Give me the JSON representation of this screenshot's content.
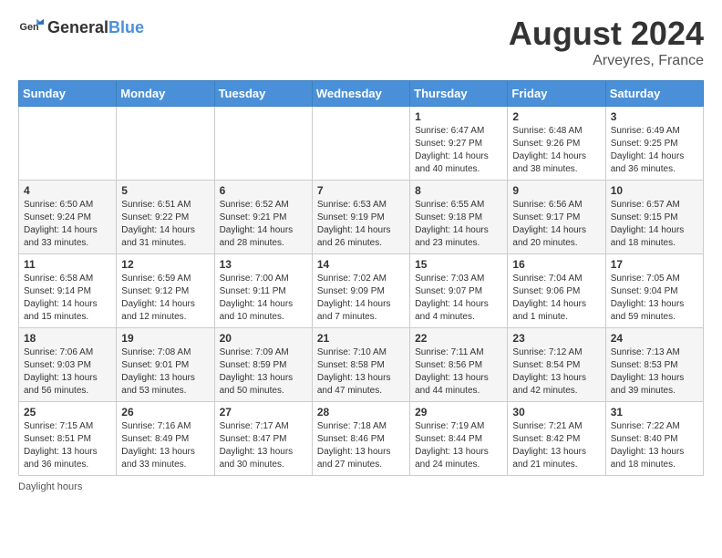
{
  "header": {
    "logo_general": "General",
    "logo_blue": "Blue",
    "month_year": "August 2024",
    "location": "Arveyres, France"
  },
  "footer": {
    "note": "Daylight hours"
  },
  "days_of_week": [
    "Sunday",
    "Monday",
    "Tuesday",
    "Wednesday",
    "Thursday",
    "Friday",
    "Saturday"
  ],
  "weeks": [
    [
      {
        "day": "",
        "info": ""
      },
      {
        "day": "",
        "info": ""
      },
      {
        "day": "",
        "info": ""
      },
      {
        "day": "",
        "info": ""
      },
      {
        "day": "1",
        "info": "Sunrise: 6:47 AM\nSunset: 9:27 PM\nDaylight: 14 hours\nand 40 minutes."
      },
      {
        "day": "2",
        "info": "Sunrise: 6:48 AM\nSunset: 9:26 PM\nDaylight: 14 hours\nand 38 minutes."
      },
      {
        "day": "3",
        "info": "Sunrise: 6:49 AM\nSunset: 9:25 PM\nDaylight: 14 hours\nand 36 minutes."
      }
    ],
    [
      {
        "day": "4",
        "info": "Sunrise: 6:50 AM\nSunset: 9:24 PM\nDaylight: 14 hours\nand 33 minutes."
      },
      {
        "day": "5",
        "info": "Sunrise: 6:51 AM\nSunset: 9:22 PM\nDaylight: 14 hours\nand 31 minutes."
      },
      {
        "day": "6",
        "info": "Sunrise: 6:52 AM\nSunset: 9:21 PM\nDaylight: 14 hours\nand 28 minutes."
      },
      {
        "day": "7",
        "info": "Sunrise: 6:53 AM\nSunset: 9:19 PM\nDaylight: 14 hours\nand 26 minutes."
      },
      {
        "day": "8",
        "info": "Sunrise: 6:55 AM\nSunset: 9:18 PM\nDaylight: 14 hours\nand 23 minutes."
      },
      {
        "day": "9",
        "info": "Sunrise: 6:56 AM\nSunset: 9:17 PM\nDaylight: 14 hours\nand 20 minutes."
      },
      {
        "day": "10",
        "info": "Sunrise: 6:57 AM\nSunset: 9:15 PM\nDaylight: 14 hours\nand 18 minutes."
      }
    ],
    [
      {
        "day": "11",
        "info": "Sunrise: 6:58 AM\nSunset: 9:14 PM\nDaylight: 14 hours\nand 15 minutes."
      },
      {
        "day": "12",
        "info": "Sunrise: 6:59 AM\nSunset: 9:12 PM\nDaylight: 14 hours\nand 12 minutes."
      },
      {
        "day": "13",
        "info": "Sunrise: 7:00 AM\nSunset: 9:11 PM\nDaylight: 14 hours\nand 10 minutes."
      },
      {
        "day": "14",
        "info": "Sunrise: 7:02 AM\nSunset: 9:09 PM\nDaylight: 14 hours\nand 7 minutes."
      },
      {
        "day": "15",
        "info": "Sunrise: 7:03 AM\nSunset: 9:07 PM\nDaylight: 14 hours\nand 4 minutes."
      },
      {
        "day": "16",
        "info": "Sunrise: 7:04 AM\nSunset: 9:06 PM\nDaylight: 14 hours\nand 1 minute."
      },
      {
        "day": "17",
        "info": "Sunrise: 7:05 AM\nSunset: 9:04 PM\nDaylight: 13 hours\nand 59 minutes."
      }
    ],
    [
      {
        "day": "18",
        "info": "Sunrise: 7:06 AM\nSunset: 9:03 PM\nDaylight: 13 hours\nand 56 minutes."
      },
      {
        "day": "19",
        "info": "Sunrise: 7:08 AM\nSunset: 9:01 PM\nDaylight: 13 hours\nand 53 minutes."
      },
      {
        "day": "20",
        "info": "Sunrise: 7:09 AM\nSunset: 8:59 PM\nDaylight: 13 hours\nand 50 minutes."
      },
      {
        "day": "21",
        "info": "Sunrise: 7:10 AM\nSunset: 8:58 PM\nDaylight: 13 hours\nand 47 minutes."
      },
      {
        "day": "22",
        "info": "Sunrise: 7:11 AM\nSunset: 8:56 PM\nDaylight: 13 hours\nand 44 minutes."
      },
      {
        "day": "23",
        "info": "Sunrise: 7:12 AM\nSunset: 8:54 PM\nDaylight: 13 hours\nand 42 minutes."
      },
      {
        "day": "24",
        "info": "Sunrise: 7:13 AM\nSunset: 8:53 PM\nDaylight: 13 hours\nand 39 minutes."
      }
    ],
    [
      {
        "day": "25",
        "info": "Sunrise: 7:15 AM\nSunset: 8:51 PM\nDaylight: 13 hours\nand 36 minutes."
      },
      {
        "day": "26",
        "info": "Sunrise: 7:16 AM\nSunset: 8:49 PM\nDaylight: 13 hours\nand 33 minutes."
      },
      {
        "day": "27",
        "info": "Sunrise: 7:17 AM\nSunset: 8:47 PM\nDaylight: 13 hours\nand 30 minutes."
      },
      {
        "day": "28",
        "info": "Sunrise: 7:18 AM\nSunset: 8:46 PM\nDaylight: 13 hours\nand 27 minutes."
      },
      {
        "day": "29",
        "info": "Sunrise: 7:19 AM\nSunset: 8:44 PM\nDaylight: 13 hours\nand 24 minutes."
      },
      {
        "day": "30",
        "info": "Sunrise: 7:21 AM\nSunset: 8:42 PM\nDaylight: 13 hours\nand 21 minutes."
      },
      {
        "day": "31",
        "info": "Sunrise: 7:22 AM\nSunset: 8:40 PM\nDaylight: 13 hours\nand 18 minutes."
      }
    ]
  ]
}
